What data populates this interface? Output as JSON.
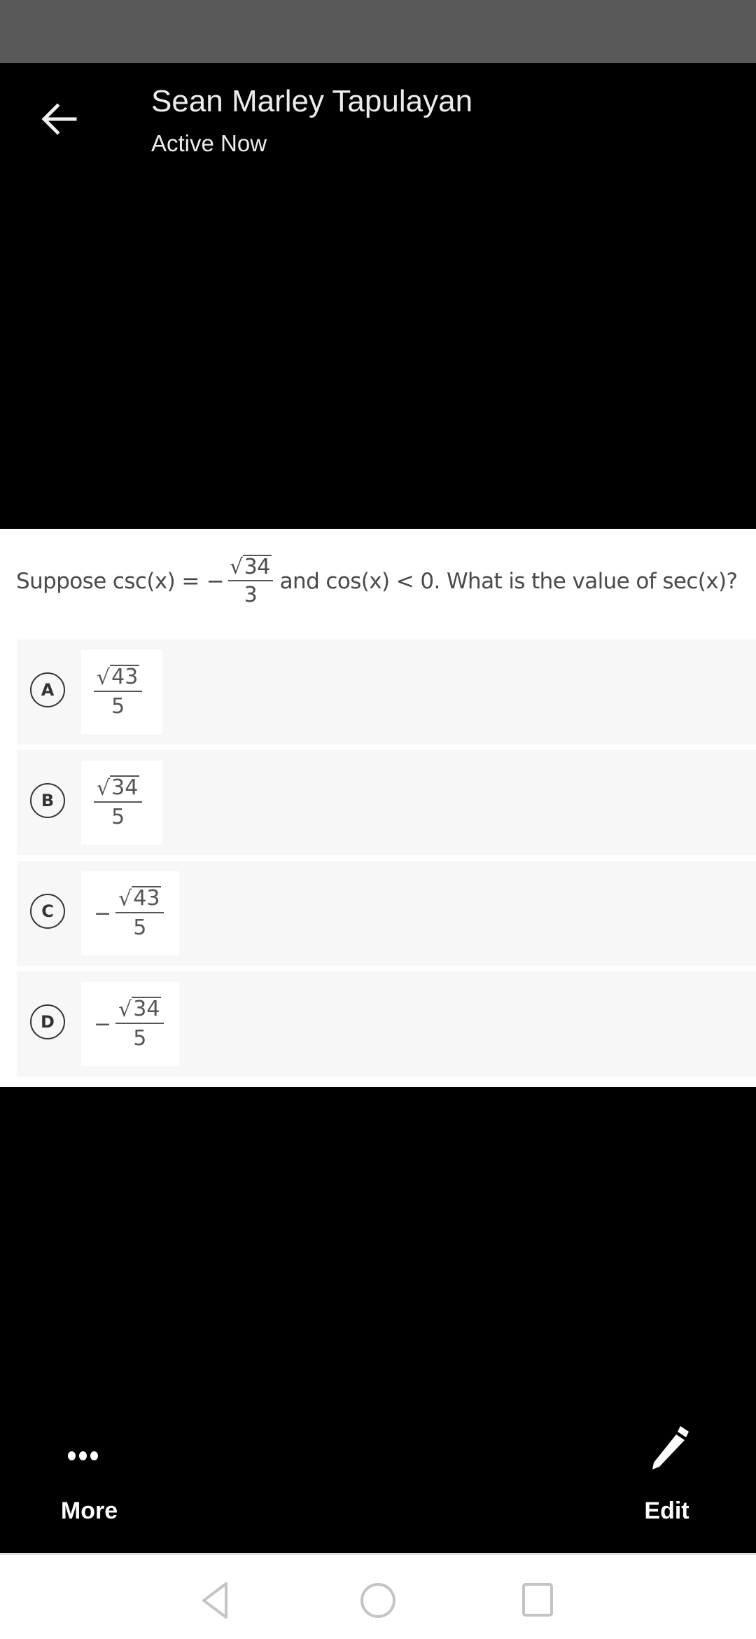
{
  "header": {
    "contact_name": "Sean Marley Tapulayan",
    "contact_status": "Active Now",
    "back_icon": "arrow-left-icon"
  },
  "question": {
    "prefix": "Suppose csc(x) =",
    "sign": "−",
    "numerator_radicand": "34",
    "denominator": "3",
    "suffix": "and cos(x) < 0. What is the value of sec(x)?"
  },
  "options": [
    {
      "letter": "A",
      "sign": "",
      "radicand": "43",
      "denominator": "5"
    },
    {
      "letter": "B",
      "sign": "",
      "radicand": "34",
      "denominator": "5"
    },
    {
      "letter": "C",
      "sign": "−",
      "radicand": "43",
      "denominator": "5"
    },
    {
      "letter": "D",
      "sign": "−",
      "radicand": "34",
      "denominator": "5"
    }
  ],
  "actions": {
    "more_label": "More",
    "more_icon": "more-horizontal-icon",
    "edit_label": "Edit",
    "edit_icon": "pencil-icon"
  },
  "system_nav": {
    "back": "triangle-back-icon",
    "home": "circle-home-icon",
    "recents": "square-recents-icon"
  },
  "colors": {
    "status_bar": "#595959",
    "background": "#000000",
    "option_card": "#f7f7f7",
    "nav_icon": "#c4c4c4"
  },
  "sqrt_symbol": "√"
}
